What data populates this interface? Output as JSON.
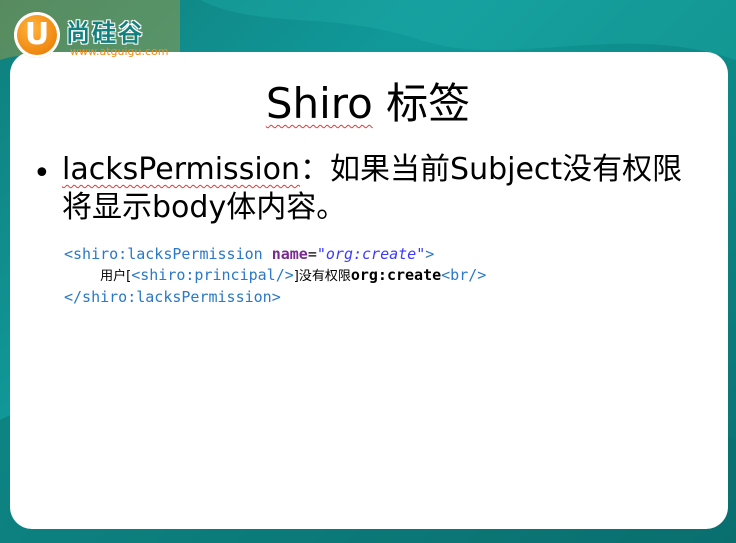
{
  "logo": {
    "mark": "U",
    "name": "尚硅谷",
    "url": "www.atguigu.com"
  },
  "slide": {
    "title_part1": "Shiro",
    "title_part2": " 标签",
    "bullet": {
      "term": "lacksPermission",
      "text": "：如果当前Subject没有权限将显示body体内容。"
    },
    "code": {
      "line1": {
        "open_tag": "<shiro:lacksPermission",
        "attr_name": "name",
        "eq": "=",
        "attr_value": "\"org:create\"",
        "close_bracket": ">"
      },
      "line2": {
        "indent": "    ",
        "text_before": "用户[",
        "inner_tag": "<shiro:principal/>",
        "text_mid": "]没有权限",
        "text_bold": "org:create",
        "br_tag": "<br/>"
      },
      "line3": {
        "close_tag": "</shiro:lacksPermission>"
      }
    }
  },
  "colors": {
    "background": "#11999a",
    "tag": "#2a78c8",
    "attribute": "#7a2b8f",
    "value": "#3a3aff",
    "logo_orange": "#f08a12"
  }
}
